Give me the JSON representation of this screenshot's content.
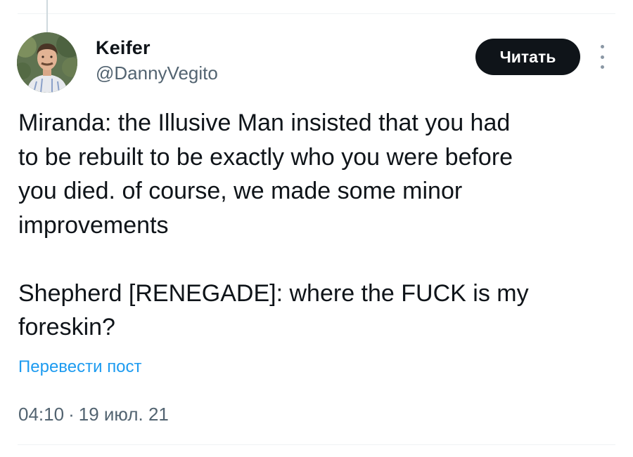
{
  "author": {
    "display_name": "Keifer",
    "handle": "@DannyVegito",
    "avatar_icon": "profile-photo"
  },
  "actions": {
    "follow_label": "Читать",
    "more_icon": "more-dots-vertical-icon"
  },
  "tweet": {
    "paragraphs": [
      "Miranda: the Illusive Man insisted that you had\nto be rebuilt to be exactly who you were before\nyou died. of course, we made some minor\nimprovements",
      "Shepherd [RENEGADE]: where the FUCK is my\nforeskin?"
    ],
    "translate_label": "Перевести пост",
    "time": "04:10",
    "separator": "·",
    "date": "19 июл. 21"
  },
  "colors": {
    "text": "#0f1419",
    "secondary_text": "#536471",
    "link": "#1d9bf0",
    "button_bg": "#0f1419",
    "button_text": "#ffffff",
    "divider": "#eff3f4"
  }
}
